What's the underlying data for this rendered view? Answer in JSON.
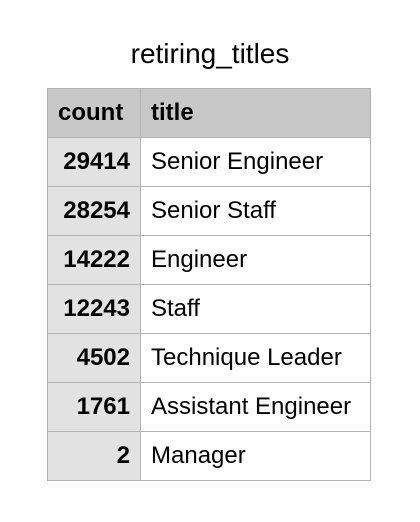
{
  "table_name": "retiring_titles",
  "columns": [
    "count",
    "title"
  ],
  "rows": [
    {
      "count": "29414",
      "title": "Senior Engineer"
    },
    {
      "count": "28254",
      "title": "Senior Staff"
    },
    {
      "count": "14222",
      "title": "Engineer"
    },
    {
      "count": "12243",
      "title": "Staff"
    },
    {
      "count": "4502",
      "title": "Technique Leader"
    },
    {
      "count": "1761",
      "title": "Assistant Engineer"
    },
    {
      "count": "2",
      "title": "Manager"
    }
  ],
  "colors": {
    "header_bg": "#c8c8c8",
    "count_cell_bg": "#e2e2e2",
    "border": "#b3b3b3"
  }
}
